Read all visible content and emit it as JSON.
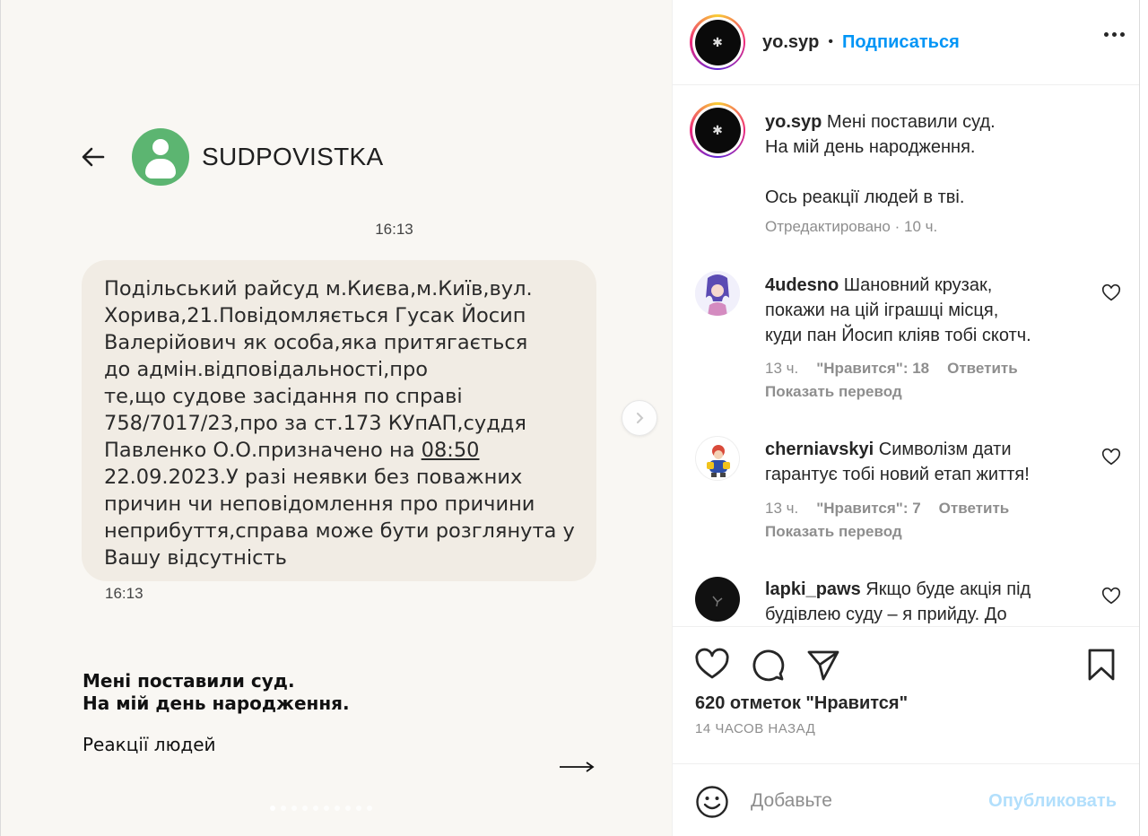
{
  "media": {
    "sms_sender": "SUDPOVISTKA",
    "sms_time_top": "16:13",
    "sms_text_lines": [
      "Подільський райсуд м.Києва,м.Київ,вул.",
      "Хорива,21.Повідомляється Гусак Йосип",
      "Валерійович як особа,яка притягається",
      "до адмін.відповідальності,про",
      "те,що судове засідання по справі",
      "758/7017/23,про за ст.173 КУпАП,суддя",
      "Павленко О.О.призначено на ",
      "08:50",
      "22.09.2023.У разі неявки без поважних",
      "причин чи неповідомлення про причини",
      "неприбуття,справа може бути розглянута у",
      "Вашу відсутність"
    ],
    "sms_time_bottom": "16:13",
    "caption_line1": "Мені поставили суд.",
    "caption_line2": "На мій день народження.",
    "caption_sub": "Реакції людей",
    "icons": {
      "back": "back-arrow-icon",
      "next": "chevron-right-icon",
      "forward": "long-arrow-icon"
    },
    "dot_count": 10,
    "active_dot": 0
  },
  "post": {
    "username": "yo.syp",
    "separator": "•",
    "follow_label": "Подписаться",
    "caption_user": "yo.syp",
    "caption_l1": " Мені поставили суд.",
    "caption_l2": "На мій день народження.",
    "caption_l3": "Ось реакції людей в тві.",
    "caption_meta": "Отредактировано · 10 ч."
  },
  "comments": [
    {
      "user": "4udesno",
      "text_l1": " Шановний крузак,",
      "text_l2": "покажи на цій іграшці місця,",
      "text_l3": "куди пан Йосип кліяв тобі скотч.",
      "time": "13 ч.",
      "likes": "\"Нравится\": 18",
      "reply": "Ответить",
      "translate": "Показать перевод"
    },
    {
      "user": "cherniavskyi",
      "text_l1": " Символізм дати",
      "text_l2": "гарантує тобі новий етап життя!",
      "time": "13 ч.",
      "likes": "\"Нравится\": 7",
      "reply": "Ответить",
      "translate": "Показать перевод"
    },
    {
      "user": "lapki_paws",
      "text_l1": " Якщо буде акція під",
      "text_l2": "будівлею суду – я прийду. До"
    }
  ],
  "actions": {
    "likes_count": "620 отметок \"Нравится\"",
    "time_ago": "14 ЧАСОВ НАЗАД"
  },
  "add_comment": {
    "placeholder": "Добавьте",
    "publish_label": "Опубликовать"
  },
  "colors": {
    "link_blue": "#0095f6",
    "publish_disabled": "#b2dffc",
    "sms_avatar_green": "#5cb571",
    "bubble_bg": "#f1ece4"
  }
}
